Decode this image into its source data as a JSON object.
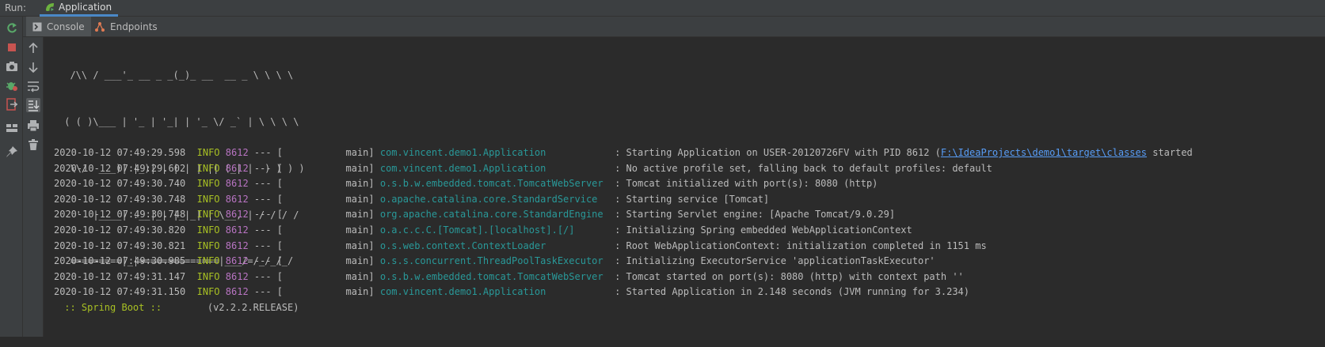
{
  "run_bar": {
    "label": "Run:",
    "app_tab": "Application"
  },
  "tabs": [
    {
      "label": "Console"
    },
    {
      "label": "Endpoints"
    }
  ],
  "banner": [
    "  /\\\\ / ___'_ __ _ _(_)_ __  __ _ \\ \\ \\ \\",
    " ( ( )\\___ | '_ | '_| | '_ \\/ _` | \\ \\ \\ \\",
    "  \\\\/  ___)| |_)| | | | | || (_| |  ) ) ) )",
    "   '  |____| .__|_| |_|_| |_\\__, | / / / /",
    "  =========|_|==============|___/=/_/_/_/"
  ],
  "boot": {
    "label": " :: Spring Boot :: ",
    "version": "       (v2.2.2.RELEASE)"
  },
  "logs": [
    {
      "ts": "2020-10-12 07:49:29.598",
      "level": "INFO",
      "pid": "8612",
      "sep": "--- [",
      "thread": "           main]",
      "logger": "com.vincent.demo1.Application           ",
      "msg": ": Starting Application on USER-20120726FV with PID 8612 (",
      "link": "F:\\IdeaProjects\\demo1\\target\\classes",
      "tail": " started"
    },
    {
      "ts": "2020-10-12 07:49:29.602",
      "level": "INFO",
      "pid": "8612",
      "sep": "--- [",
      "thread": "           main]",
      "logger": "com.vincent.demo1.Application           ",
      "msg": ": No active profile set, falling back to default profiles: default"
    },
    {
      "ts": "2020-10-12 07:49:30.740",
      "level": "INFO",
      "pid": "8612",
      "sep": "--- [",
      "thread": "           main]",
      "logger": "o.s.b.w.embedded.tomcat.TomcatWebServer ",
      "msg": ": Tomcat initialized with port(s): 8080 (http)"
    },
    {
      "ts": "2020-10-12 07:49:30.748",
      "level": "INFO",
      "pid": "8612",
      "sep": "--- [",
      "thread": "           main]",
      "logger": "o.apache.catalina.core.StandardService  ",
      "msg": ": Starting service [Tomcat]"
    },
    {
      "ts": "2020-10-12 07:49:30.748",
      "level": "INFO",
      "pid": "8612",
      "sep": "--- [",
      "thread": "           main]",
      "logger": "org.apache.catalina.core.StandardEngine ",
      "msg": ": Starting Servlet engine: [Apache Tomcat/9.0.29]"
    },
    {
      "ts": "2020-10-12 07:49:30.820",
      "level": "INFO",
      "pid": "8612",
      "sep": "--- [",
      "thread": "           main]",
      "logger": "o.a.c.c.C.[Tomcat].[localhost].[/]      ",
      "msg": ": Initializing Spring embedded WebApplicationContext"
    },
    {
      "ts": "2020-10-12 07:49:30.821",
      "level": "INFO",
      "pid": "8612",
      "sep": "--- [",
      "thread": "           main]",
      "logger": "o.s.web.context.ContextLoader           ",
      "msg": ": Root WebApplicationContext: initialization completed in 1151 ms"
    },
    {
      "ts": "2020-10-12 07:49:30.985",
      "level": "INFO",
      "pid": "8612",
      "sep": "--- [",
      "thread": "           main]",
      "logger": "o.s.s.concurrent.ThreadPoolTaskExecutor ",
      "msg": ": Initializing ExecutorService 'applicationTaskExecutor'"
    },
    {
      "ts": "2020-10-12 07:49:31.147",
      "level": "INFO",
      "pid": "8612",
      "sep": "--- [",
      "thread": "           main]",
      "logger": "o.s.b.w.embedded.tomcat.TomcatWebServer ",
      "msg": ": Tomcat started on port(s): 8080 (http) with context path ''"
    },
    {
      "ts": "2020-10-12 07:49:31.150",
      "level": "INFO",
      "pid": "8612",
      "sep": "--- [",
      "thread": "           main]",
      "logger": "com.vincent.demo1.Application           ",
      "msg": ": Started Application in 2.148 seconds (JVM running for 3.234)"
    }
  ],
  "icons": {
    "left_toolbar": [
      "rerun-icon",
      "stop-icon",
      "camera-icon",
      "debug-icon",
      "exit-icon",
      "layout-icon",
      "pin-icon"
    ],
    "inner_toolbar": [
      "up-arrow-icon",
      "down-arrow-icon",
      "soft-wrap-icon",
      "scroll-to-end-icon",
      "print-icon",
      "trash-icon"
    ]
  },
  "colors": {
    "background": "#2b2b2b",
    "panel": "#3c3f41",
    "info": "#a8c023",
    "pid": "#b874c2",
    "logger": "#299999",
    "link": "#589df6",
    "text": "#bbbbbb"
  }
}
